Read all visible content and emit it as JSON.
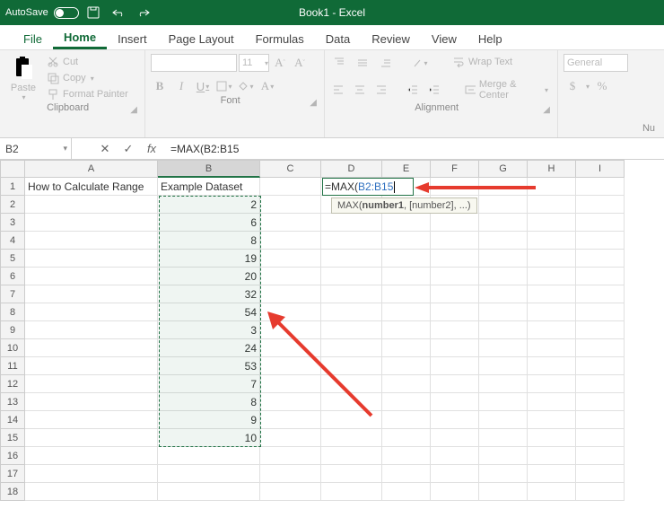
{
  "titlebar": {
    "autosave_label": "AutoSave",
    "autosave_state": "Off",
    "document_title": "Book1 - Excel"
  },
  "tabs": {
    "file": "File",
    "home": "Home",
    "insert": "Insert",
    "page_layout": "Page Layout",
    "formulas": "Formulas",
    "data": "Data",
    "review": "Review",
    "view": "View",
    "help": "Help"
  },
  "ribbon": {
    "clipboard": {
      "paste": "Paste",
      "cut": "Cut",
      "copy": "Copy",
      "format_painter": "Format Painter",
      "label": "Clipboard"
    },
    "font": {
      "size": "11",
      "bold": "B",
      "italic": "I",
      "underline": "U",
      "label": "Font"
    },
    "alignment": {
      "wrap_text": "Wrap Text",
      "merge": "Merge & Center",
      "label": "Alignment"
    },
    "number": {
      "general": "General",
      "currency": "$",
      "percent": "%",
      "label": "Nu"
    }
  },
  "formula_bar": {
    "name_box": "B2",
    "formula": "=MAX(B2:B15"
  },
  "columns": [
    "A",
    "B",
    "C",
    "D",
    "E",
    "F",
    "G",
    "H",
    "I"
  ],
  "rows": [
    "1",
    "2",
    "3",
    "4",
    "5",
    "6",
    "7",
    "8",
    "9",
    "10",
    "11",
    "12",
    "13",
    "14",
    "15",
    "16",
    "17",
    "18"
  ],
  "cells": {
    "A1": "How to Calculate Range",
    "B1": "Example Dataset",
    "B2": "2",
    "B3": "6",
    "B4": "8",
    "B5": "19",
    "B6": "20",
    "B7": "32",
    "B8": "54",
    "B9": "3",
    "B10": "24",
    "B11": "53",
    "B12": "7",
    "B13": "8",
    "B14": "9",
    "B15": "10"
  },
  "editing_cell": {
    "prefix": "=MAX(",
    "ref": "B2:B15"
  },
  "fn_tooltip_parts": {
    "name": "MAX(",
    "arg1": "number1",
    "rest": ", [number2], ...)"
  }
}
